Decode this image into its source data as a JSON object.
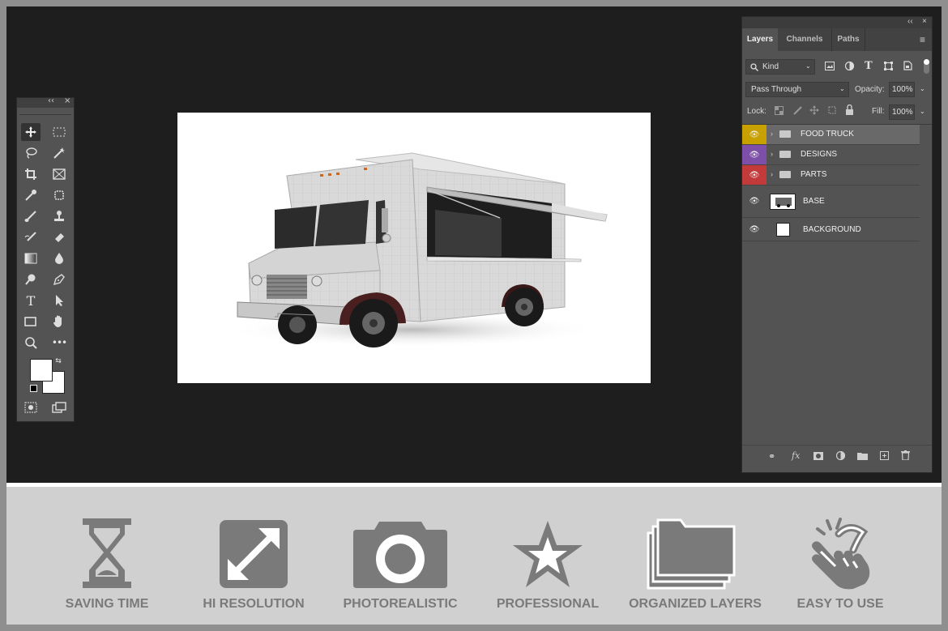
{
  "toolbox": {
    "collapse_label": "‹‹",
    "close_label": "×",
    "tools": [
      "move-tool",
      "marquee-tool",
      "lasso-tool",
      "magic-wand-tool",
      "crop-tool",
      "frame-tool",
      "eyedropper-tool",
      "patch-tool",
      "brush-tool",
      "stamp-tool",
      "history-brush-tool",
      "eraser-tool",
      "gradient-tool",
      "blur-tool",
      "dodge-tool",
      "pen-tool",
      "type-tool",
      "path-selection-tool",
      "rectangle-tool",
      "hand-tool",
      "zoom-tool",
      "more-tools"
    ],
    "more_label": "•••"
  },
  "panel": {
    "collapse_label": "‹‹",
    "close_label": "×",
    "tabs": [
      "Layers",
      "Channels",
      "Paths"
    ],
    "filter": {
      "label": "Kind"
    },
    "blend_mode": "Pass Through",
    "opacity_label": "Opacity:",
    "opacity_value": "100%",
    "lock_label": "Lock:",
    "fill_label": "Fill:",
    "fill_value": "100%",
    "layers": [
      {
        "name": "FOOD TRUCK",
        "type": "group",
        "color": "#c8a000"
      },
      {
        "name": "DESIGNS",
        "type": "group",
        "color": "#7d4fa8"
      },
      {
        "name": "PARTS",
        "type": "group",
        "color": "#c23a3a"
      },
      {
        "name": "BASE",
        "type": "smart-object",
        "color": ""
      },
      {
        "name": "BACKGROUND",
        "type": "fill",
        "color": ""
      }
    ]
  },
  "features": [
    {
      "label": "SAVING TIME",
      "icon": "hourglass-icon"
    },
    {
      "label": "HI RESOLUTION",
      "icon": "expand-arrows-icon"
    },
    {
      "label": "PHOTOREALISTIC",
      "icon": "camera-icon"
    },
    {
      "label": "PROFESSIONAL",
      "icon": "star-icon"
    },
    {
      "label": "ORGANIZED LAYERS",
      "icon": "stacked-folders-icon"
    },
    {
      "label": "EASY TO USE",
      "icon": "tap-hand-icon"
    }
  ],
  "colors": {
    "workspace": "#1e1e1e",
    "panel": "#535353",
    "feature_gray": "#7a7a7a"
  }
}
